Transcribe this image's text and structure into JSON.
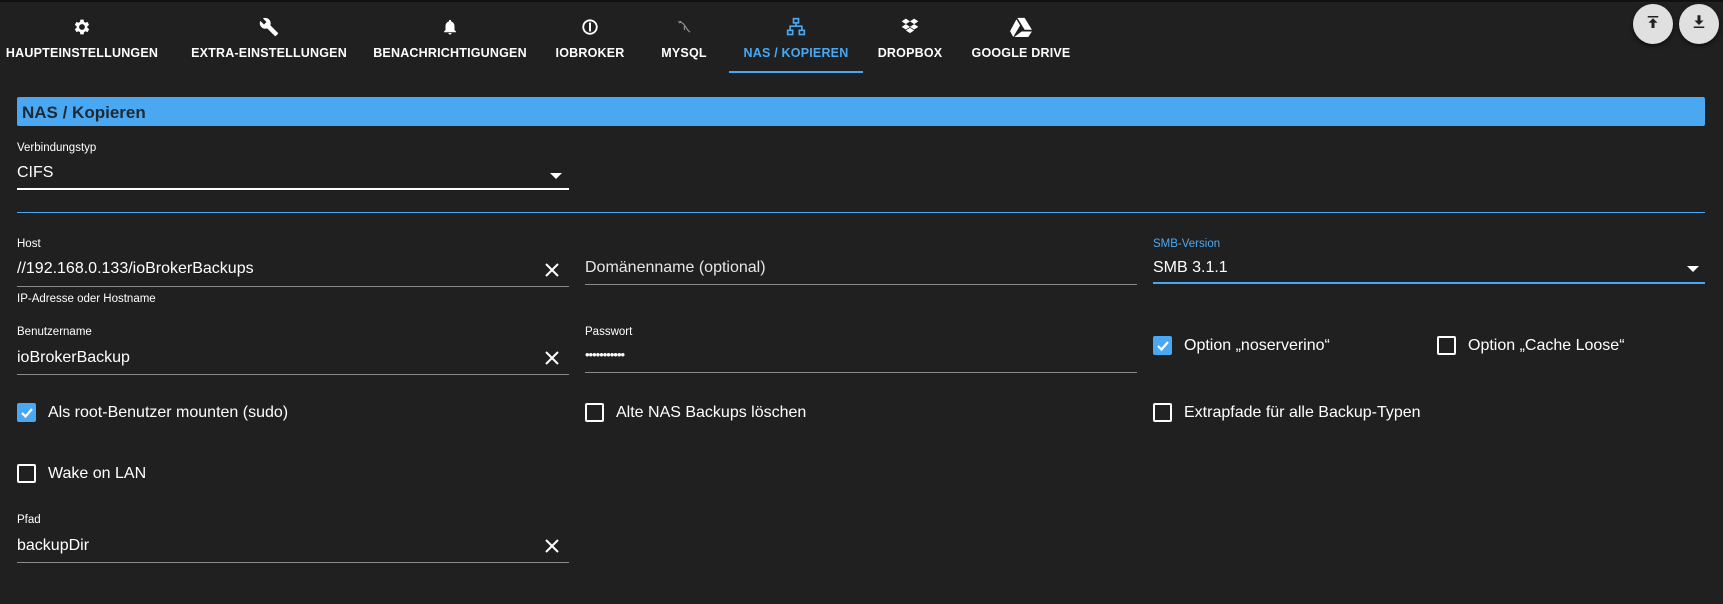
{
  "tabs": [
    {
      "label": "HAUPTEINSTELLUNGEN",
      "icon": "gear-icon"
    },
    {
      "label": "EXTRA-EINSTELLUNGEN",
      "icon": "wrench-icon"
    },
    {
      "label": "BENACHRICHTIGUNGEN",
      "icon": "bell-icon"
    },
    {
      "label": "IOBROKER",
      "icon": "iobroker-icon"
    },
    {
      "label": "MYSQL",
      "icon": "mysql-icon"
    },
    {
      "label": "NAS / KOPIEREN",
      "icon": "network-icon",
      "active": true
    },
    {
      "label": "DROPBOX",
      "icon": "dropbox-icon"
    },
    {
      "label": "GOOGLE DRIVE",
      "icon": "google-drive-icon"
    }
  ],
  "actions": {
    "upload_icon": "upload-icon",
    "download_icon": "download-icon"
  },
  "section": {
    "title": "NAS / Kopieren"
  },
  "connection_type": {
    "label": "Verbindungstyp",
    "value": "CIFS"
  },
  "host": {
    "label": "Host",
    "value": "//192.168.0.133/ioBrokerBackups",
    "helper": "IP-Adresse oder Hostname"
  },
  "domain": {
    "placeholder": "Domänenname (optional)"
  },
  "smb_version": {
    "label": "SMB-Version",
    "value": "SMB 3.1.1"
  },
  "username": {
    "label": "Benutzername",
    "value": "ioBrokerBackup"
  },
  "password": {
    "label": "Passwort",
    "value": "•••••••••••"
  },
  "checkboxes": {
    "noserverino": {
      "label": "Option „noserverino“",
      "checked": true
    },
    "cache_loose": {
      "label": "Option „Cache Loose“",
      "checked": false
    },
    "sudo": {
      "label": "Als root-Benutzer mounten (sudo)",
      "checked": true
    },
    "delete_old": {
      "label": "Alte NAS Backups löschen",
      "checked": false
    },
    "extrapaths": {
      "label": "Extrapfade für alle Backup-Typen",
      "checked": false
    },
    "wol": {
      "label": "Wake on LAN",
      "checked": false
    }
  },
  "path": {
    "label": "Pfad",
    "value": "backupDir"
  },
  "colors": {
    "accent": "#4aa8f2",
    "background": "#202020",
    "text": "#ffffff"
  }
}
